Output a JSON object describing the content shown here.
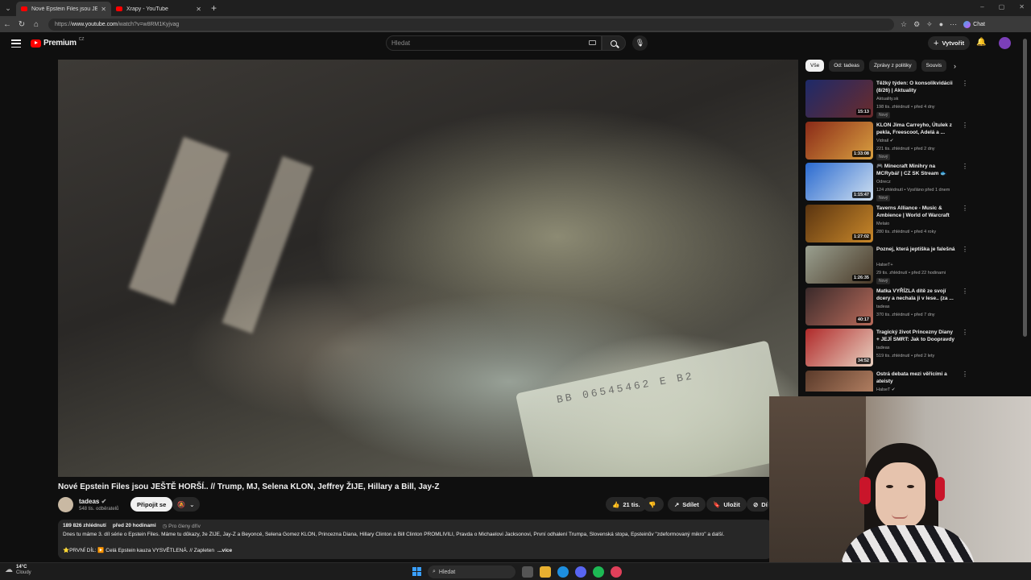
{
  "browser": {
    "tabs": [
      {
        "label": "Nové Epstein Files jsou JEŠTĚ HORŠ"
      },
      {
        "label": "Xrapy - YouTube"
      }
    ],
    "url_prefix": "https://",
    "url_host": "www.youtube.com",
    "url_path": "/watch?v=w8RM1Kyjvag",
    "chat_label": "Chat"
  },
  "masthead": {
    "logo_text": "Premium",
    "logo_sup": "CZ",
    "search_placeholder": "Hledat",
    "create_label": "Vytvořit"
  },
  "video": {
    "serial_text": "BB 06545462 E B2",
    "title": "Nové Epstein Files jsou JEŠTĚ HORŠÍ.. // Trump, MJ, Selena KLON, Jeffrey ŽIJE, Hillary a Bill, Jay-Z",
    "channel": "tadeas",
    "subscribers": "548 tis. odběratelů",
    "join_label": "Připojit se",
    "like_count": "21 tis.",
    "share_label": "Sdílet",
    "save_label": "Uložit",
    "more_label": "Dí"
  },
  "description": {
    "views": "189 826 zhlédnutí",
    "date": "před 20 hodinami",
    "members": "Pro členy dřív",
    "text": "Dnes tu máme 3. díl série o Epstein Files. Máme tu důkazy, že ŽIJE, Jay-Z a Beyoncé, Selena Gomez KLON, Princezna Diana, Hillary Clinton a Bill Clinton PROMLIVILI, Pravda o Michaelovi Jacksonovi, První odhalení Trumpa, Slovenská stopa, Epsteinův \"zdeformovaný mikro\" a další.",
    "first_part": "⭐PRVNÍ DÍL: ▶️ Celá Epstein kauza VYSVĚTLENÁ. // Zapleten",
    "more_label": "...více"
  },
  "sidebar": {
    "chips": [
      "Vše",
      "Od: tadeas",
      "Zprávy z politiky",
      "Souvis"
    ],
    "recommendations": [
      {
        "title": "Těžký týden: O konsolikvidácii (8/26) | Aktuality",
        "channel": "Aktuality.sk",
        "meta": "198 tis. zhlédnutí • před 4 dny",
        "badge": "Nový",
        "duration": "15:13",
        "c1": "#1d2a6a",
        "c2": "#6b2b2b"
      },
      {
        "title": "KLON Jima Carreyho, Útulek z pekla, Freescoot, Adelá a ...",
        "channel": "Vidrail ✔",
        "meta": "221 tis. zhlédnutí • před 2 dny",
        "badge": "Nový",
        "duration": "1:33:08",
        "c1": "#8a2a18",
        "c2": "#d9a040"
      },
      {
        "title": "🎮 Minecraft Minihry na MCRybář | CZ SK Stream 🐟",
        "channel": "Odrecz",
        "meta": "124 zhlédnutí • Vysíláno před 1 dnem",
        "badge": "Nový",
        "duration": "1:15:47",
        "c1": "#2a6ad0",
        "c2": "#d0e0f0"
      },
      {
        "title": "Taverns Alliance - Music & Ambience | World of Warcraft",
        "channel": "Melaio",
        "meta": "280 tis. zhlédnutí • před 4 roky",
        "badge": "",
        "duration": "1:27:02",
        "c1": "#5a3410",
        "c2": "#c9882a"
      },
      {
        "title": "Poznej, která jeptiška je falešná",
        "channel": "HalseT+",
        "meta": "29 tis. zhlédnutí • před 22 hodinami",
        "badge": "Nový",
        "duration": "1:26:35",
        "c1": "#9aa090",
        "c2": "#4a3a28"
      },
      {
        "title": "Matka VYŘÍZLA dítě ze svojí dcery a nechala ji v lese.. (za ...",
        "channel": "tadeas",
        "meta": "370 tis. zhlédnutí • před 7 dny",
        "badge": "",
        "duration": "40:17",
        "c1": "#3a2a2a",
        "c2": "#b86a5a"
      },
      {
        "title": "Tragický život Princezny Diany + JEJÍ SMRT: Jak to Doopravdy ...",
        "channel": "tadeas",
        "meta": "519 tis. zhlédnutí • před 2 lety",
        "badge": "",
        "duration": "34:52",
        "c1": "#b02a2a",
        "c2": "#e8d0c0"
      },
      {
        "title": "Ostrá debata mezi věřícími a ateisty",
        "channel": "HalseT ✔",
        "meta": "",
        "badge": "",
        "duration": "",
        "c1": "#5a3a2a",
        "c2": "#c08a6a"
      }
    ]
  },
  "taskbar": {
    "temp": "14°C",
    "condition": "Cloudy",
    "search_label": "Hledat"
  }
}
